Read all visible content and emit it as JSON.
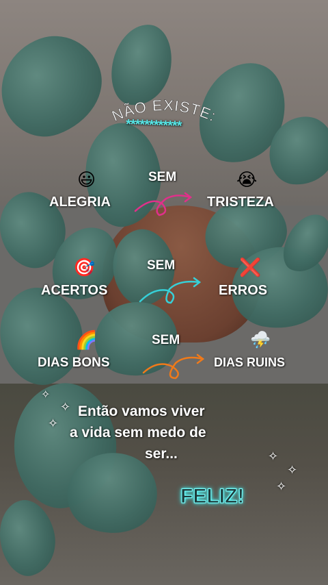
{
  "title": "NÃO EXISTE:",
  "stars": "************",
  "rows": [
    {
      "left_emoji": "😃",
      "left": "ALEGRIA",
      "mid": "SEM",
      "right_emoji": "😭",
      "right": "TRISTEZA",
      "arrow_color": "#e0308a"
    },
    {
      "left_emoji": "🎯",
      "left": "ACERTOS",
      "mid": "SEM",
      "right_emoji": "❌",
      "right": "ERROS",
      "arrow_color": "#36d0d8"
    },
    {
      "left_emoji": "🌈",
      "left": "DIAS BONS",
      "mid": "SEM",
      "right_emoji": "⛈️",
      "right": "DIAS RUINS",
      "arrow_color": "#f07a1a"
    }
  ],
  "message": [
    "Então vamos viver",
    "a vida sem medo de",
    "ser..."
  ],
  "feliz": "FELIZ!",
  "sparkle_icon": "✧"
}
